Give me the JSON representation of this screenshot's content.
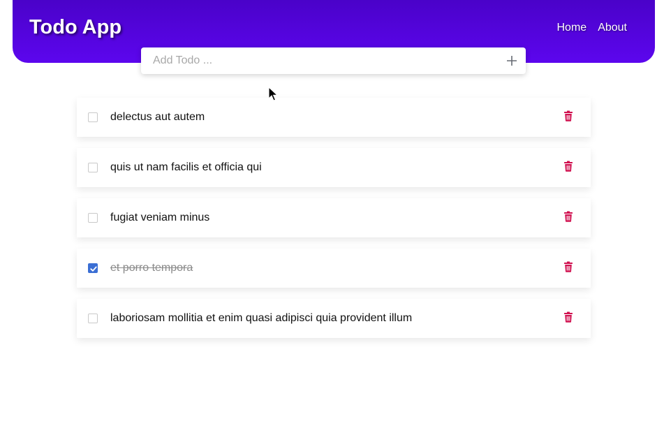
{
  "header": {
    "title": "Todo App",
    "nav": [
      "Home",
      "About"
    ]
  },
  "add_todo": {
    "placeholder": "Add Todo ...",
    "icon": "plus-icon"
  },
  "todos": [
    {
      "text": "delectus aut autem",
      "completed": false
    },
    {
      "text": "quis ut nam facilis et officia qui",
      "completed": false
    },
    {
      "text": "fugiat veniam minus",
      "completed": false
    },
    {
      "text": "et porro tempora",
      "completed": true
    },
    {
      "text": "laboriosam mollitia et enim quasi adipisci quia provident illum",
      "completed": false
    }
  ],
  "icons": {
    "delete": "trash-icon",
    "check": "check-icon",
    "cursor": "mouse-cursor-icon"
  },
  "colors": {
    "header_gradient_top": "#4a02c9",
    "header_gradient_bottom": "#5c06ee",
    "delete_icon": "#d0104f",
    "checkbox_checked": "#3b6fd4"
  }
}
